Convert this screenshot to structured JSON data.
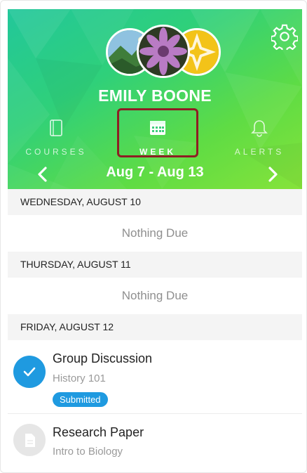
{
  "profile": {
    "name": "EMILY BOONE"
  },
  "tabs": [
    {
      "label": "COURSES",
      "icon": "book-icon"
    },
    {
      "label": "WEEK",
      "icon": "calendar-icon",
      "selected": true
    },
    {
      "label": "ALERTS",
      "icon": "bell-icon"
    }
  ],
  "week": {
    "range": "Aug 7 - Aug 13"
  },
  "days": [
    {
      "header": "WEDNESDAY, AUGUST 10",
      "empty_text": "Nothing Due"
    },
    {
      "header": "THURSDAY, AUGUST 11",
      "empty_text": "Nothing Due"
    },
    {
      "header": "FRIDAY, AUGUST 12"
    }
  ],
  "assignments": [
    {
      "title": "Group Discussion",
      "course": "History 101",
      "status": "Submitted",
      "icon": "checkmark-icon"
    },
    {
      "title": "Research Paper",
      "course": "Intro to Biology",
      "icon": "document-icon"
    }
  ],
  "colors": {
    "accent": "#1f9ae0",
    "highlight": "#8e1e24",
    "header_start": "#22c79b",
    "header_end": "#86e33a"
  }
}
